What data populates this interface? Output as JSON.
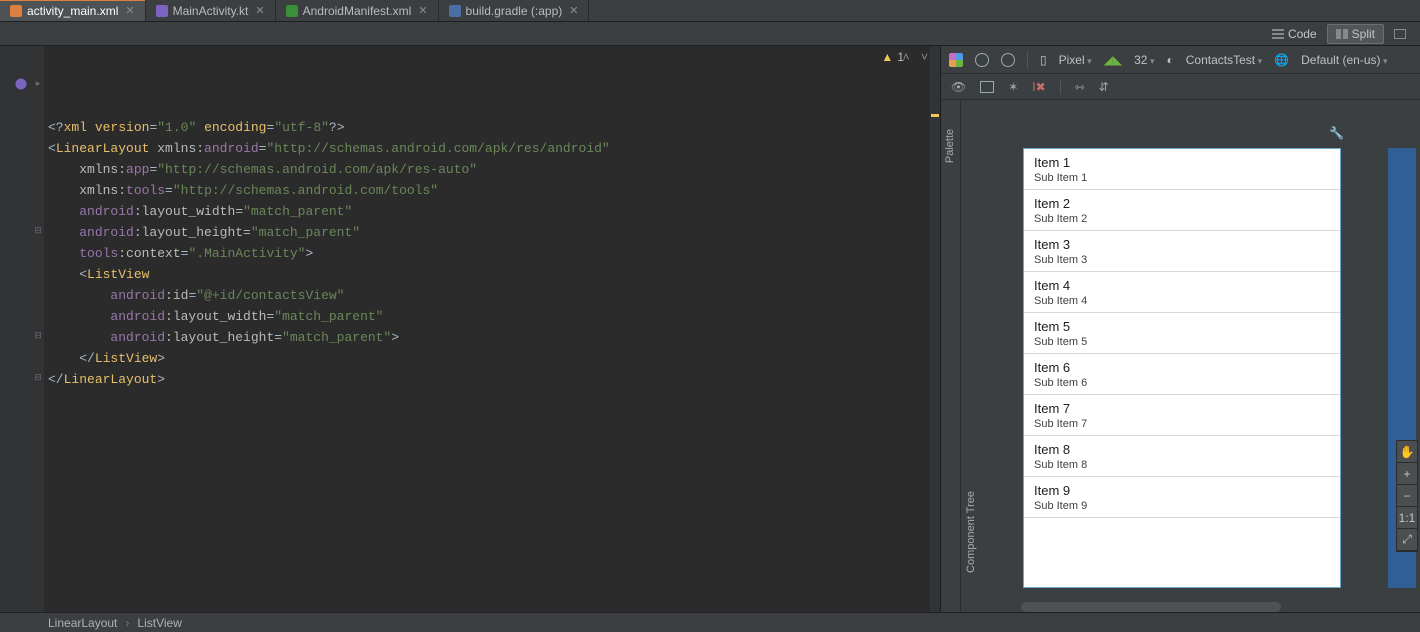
{
  "tabs": [
    {
      "label": "activity_main.xml",
      "active": true
    },
    {
      "label": "MainActivity.kt",
      "active": false
    },
    {
      "label": "AndroidManifest.xml",
      "active": false
    },
    {
      "label": "build.gradle (:app)",
      "active": false
    }
  ],
  "view_modes": {
    "code": "Code",
    "split": "Split",
    "design": "Design",
    "active": "split"
  },
  "warnings": {
    "count": "1"
  },
  "code_lines": [
    [
      {
        "c": "op",
        "t": "<?"
      },
      {
        "c": "kw",
        "t": "xml version"
      },
      {
        "c": "op",
        "t": "="
      },
      {
        "c": "str",
        "t": "\"1.0\""
      },
      {
        "c": "op",
        "t": " "
      },
      {
        "c": "kw",
        "t": "encoding"
      },
      {
        "c": "op",
        "t": "="
      },
      {
        "c": "str",
        "t": "\"utf-8\""
      },
      {
        "c": "op",
        "t": "?>"
      }
    ],
    [
      {
        "c": "op",
        "t": "<"
      },
      {
        "c": "kw",
        "t": "LinearLayout "
      },
      {
        "c": "attr-nm",
        "t": "xmlns:"
      },
      {
        "c": "attr-ns",
        "t": "android"
      },
      {
        "c": "op",
        "t": "="
      },
      {
        "c": "str",
        "t": "\"http://schemas.android.com/apk/res/android\""
      }
    ],
    [
      {
        "c": "op",
        "t": "    "
      },
      {
        "c": "attr-nm",
        "t": "xmlns:"
      },
      {
        "c": "attr-ns",
        "t": "app"
      },
      {
        "c": "op",
        "t": "="
      },
      {
        "c": "str",
        "t": "\"http://schemas.android.com/apk/res-auto\""
      }
    ],
    [
      {
        "c": "op",
        "t": "    "
      },
      {
        "c": "attr-nm",
        "t": "xmlns:"
      },
      {
        "c": "attr-ns",
        "t": "tools"
      },
      {
        "c": "op",
        "t": "="
      },
      {
        "c": "str",
        "t": "\"http://schemas.android.com/tools\""
      }
    ],
    [
      {
        "c": "op",
        "t": "    "
      },
      {
        "c": "attr-ns",
        "t": "android"
      },
      {
        "c": "attr-nm",
        "t": ":layout_width"
      },
      {
        "c": "op",
        "t": "="
      },
      {
        "c": "str",
        "t": "\"match_parent\""
      }
    ],
    [
      {
        "c": "op",
        "t": "    "
      },
      {
        "c": "attr-ns",
        "t": "android"
      },
      {
        "c": "attr-nm",
        "t": ":layout_height"
      },
      {
        "c": "op",
        "t": "="
      },
      {
        "c": "str",
        "t": "\"match_parent\""
      }
    ],
    [
      {
        "c": "op",
        "t": "    "
      },
      {
        "c": "attr-ns",
        "t": "tools"
      },
      {
        "c": "attr-nm",
        "t": ":context"
      },
      {
        "c": "op",
        "t": "="
      },
      {
        "c": "str",
        "t": "\".MainActivity\""
      },
      {
        "c": "op",
        "t": ">"
      }
    ],
    [
      {
        "c": "op",
        "t": ""
      }
    ],
    [
      {
        "c": "op",
        "t": "    <"
      },
      {
        "c": "kw",
        "t": "ListView"
      }
    ],
    [
      {
        "c": "op",
        "t": "        "
      },
      {
        "c": "attr-ns",
        "t": "android"
      },
      {
        "c": "attr-nm",
        "t": ":id"
      },
      {
        "c": "op",
        "t": "="
      },
      {
        "c": "str",
        "t": "\"@+id/contactsView\""
      }
    ],
    [
      {
        "c": "op",
        "t": "        "
      },
      {
        "c": "attr-ns",
        "t": "android"
      },
      {
        "c": "attr-nm",
        "t": ":layout_width"
      },
      {
        "c": "op",
        "t": "="
      },
      {
        "c": "str",
        "t": "\"match_parent\""
      }
    ],
    [
      {
        "c": "op",
        "t": "        "
      },
      {
        "c": "attr-ns",
        "t": "android"
      },
      {
        "c": "attr-nm",
        "t": ":layout_height"
      },
      {
        "c": "op",
        "t": "="
      },
      {
        "c": "str",
        "t": "\"match_parent\""
      },
      {
        "c": "op",
        "t": ">"
      }
    ],
    [
      {
        "c": "op",
        "t": ""
      }
    ],
    [
      {
        "c": "op",
        "t": "    </"
      },
      {
        "c": "kw",
        "t": "ListView"
      },
      {
        "c": "op",
        "t": ">"
      }
    ],
    [
      {
        "c": "op",
        "t": ""
      }
    ],
    [
      {
        "c": "op",
        "t": "</"
      },
      {
        "c": "kw",
        "t": "LinearLayout"
      },
      {
        "c": "op",
        "t": ">"
      }
    ]
  ],
  "design_toolbar": {
    "device": "Pixel",
    "api": "32",
    "theme": "ContactsTest",
    "locale": "Default (en-us)"
  },
  "side_tabs": {
    "palette": "Palette",
    "component_tree": "Component Tree"
  },
  "preview_items": [
    {
      "title": "Item 1",
      "sub": "Sub Item 1"
    },
    {
      "title": "Item 2",
      "sub": "Sub Item 2"
    },
    {
      "title": "Item 3",
      "sub": "Sub Item 3"
    },
    {
      "title": "Item 4",
      "sub": "Sub Item 4"
    },
    {
      "title": "Item 5",
      "sub": "Sub Item 5"
    },
    {
      "title": "Item 6",
      "sub": "Sub Item 6"
    },
    {
      "title": "Item 7",
      "sub": "Sub Item 7"
    },
    {
      "title": "Item 8",
      "sub": "Sub Item 8"
    },
    {
      "title": "Item 9",
      "sub": "Sub Item 9"
    }
  ],
  "zoom_controls": [
    "✋",
    "+",
    "−",
    "1:1",
    "⤢"
  ],
  "breadcrumb": [
    "LinearLayout",
    "ListView"
  ]
}
